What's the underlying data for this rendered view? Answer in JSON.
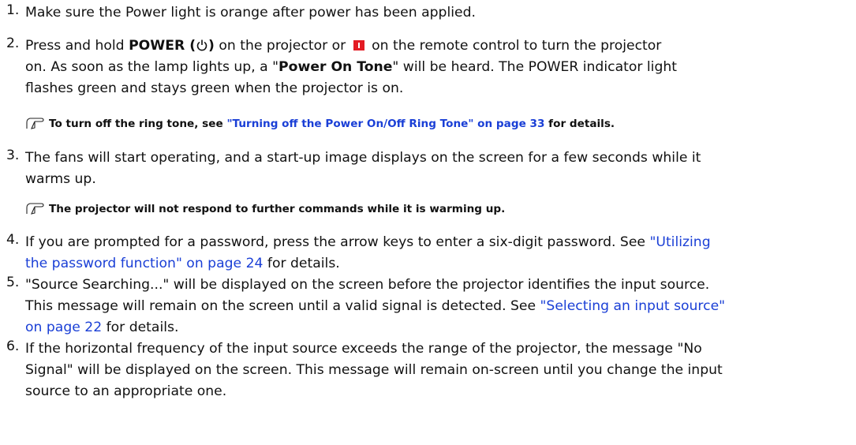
{
  "steps": [
    {
      "number": "1.",
      "text": "Make sure the Power light is orange after power has been applied."
    },
    {
      "number": "2.",
      "l1_a": "Press and hold ",
      "l1_b": "POWER (",
      "l1_c": ")",
      "l1_d": " on the projector or ",
      "l1_e": " on the remote control to turn the projector",
      "l2_a": "on. As soon as the lamp lights up, a \"",
      "l2_b": "Power On Tone",
      "l2_c": "\" will be heard. The POWER indicator light",
      "l3": "flashes green and stays green when the projector is on."
    },
    {
      "number": "3.",
      "l1": "The fans will start operating, and a start-up image displays on the screen for a few seconds while it",
      "l2": "warms up."
    },
    {
      "number": "4.",
      "l1_a": "If you are prompted for a password, press the arrow keys to enter a six-digit password. See ",
      "l1_link": "\"Utilizing",
      "l2_link": "the password function\" on page 24",
      "l2_b": " for details."
    },
    {
      "number": "5.",
      "l1": "\"Source Searching...\" will be displayed on the screen before the projector identifies the input source.",
      "l2_a": "This message will remain on the screen until a valid signal is detected. See ",
      "l2_link": "\"Selecting an input source\"",
      "l3_link": "on page 22",
      "l3_b": " for details."
    },
    {
      "number": "6.",
      "l1": "If the horizontal frequency of the input source exceeds the range of the projector, the message \"No",
      "l2": "Signal\" will be displayed on the screen. This message will remain on-screen until you change the input",
      "l3": "source to an appropriate one."
    }
  ],
  "notes": {
    "ring_a": "To turn off the ring tone, see ",
    "ring_link": "\"Turning off the Power On/Off Ring Tone\" on page 33",
    "ring_b": " for details.",
    "warm": "The projector will not respond to further commands while it is warming up."
  },
  "icons": {
    "note": "pointing-hand-icon",
    "power": "power-symbol-icon",
    "remote_power": "red-remote-power-button-icon"
  },
  "colors": {
    "link": "#1a3fd6",
    "remote_button": "#e31b23"
  }
}
